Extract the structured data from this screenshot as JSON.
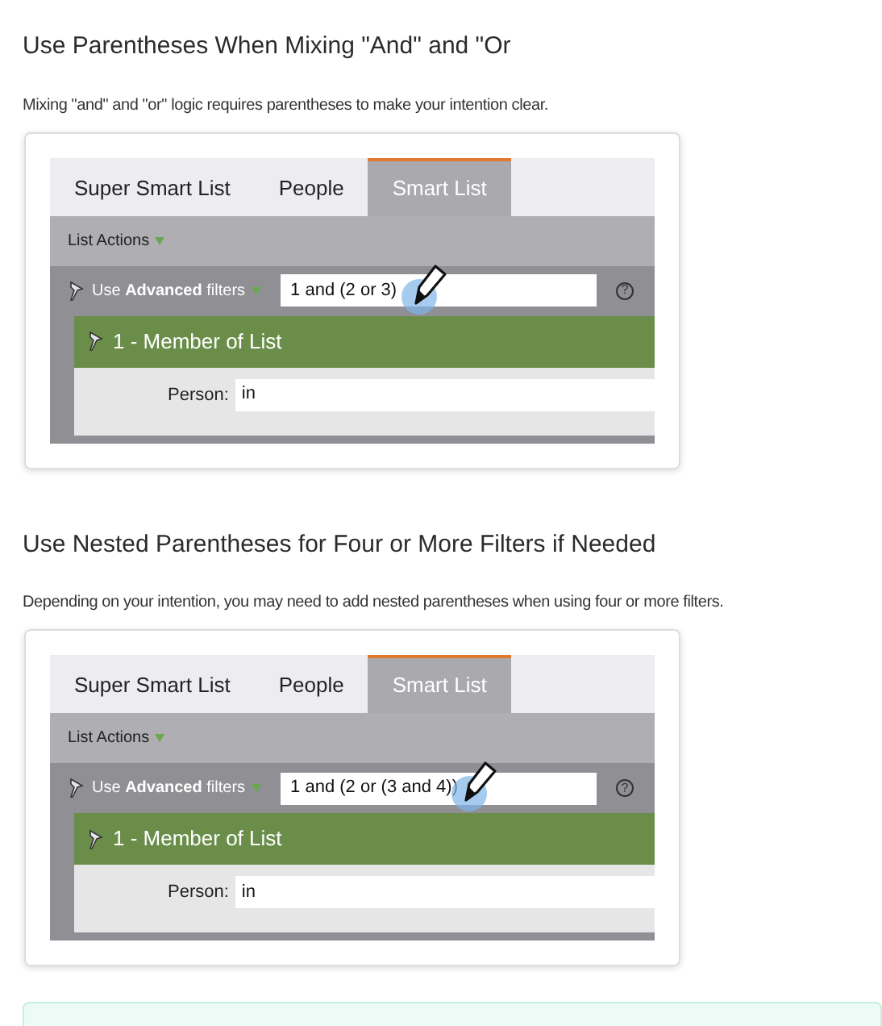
{
  "sections": [
    {
      "heading": "Use Parentheses When Mixing \"And\" and \"Or",
      "text": "Mixing \"and\" and \"or\" logic requires parentheses to make your intention clear.",
      "screenshot": {
        "tabs": [
          {
            "label": "Super Smart List",
            "selected": false
          },
          {
            "label": "People",
            "selected": false
          },
          {
            "label": "Smart List",
            "selected": true
          }
        ],
        "list_actions": "List Actions",
        "advanced_label": "Use **Advanced** filters",
        "filter_logic": "1 and (2 or 3)",
        "help": "?",
        "filter_title": "1 - Member of List",
        "field_label": "Person:",
        "field_value": "in"
      }
    },
    {
      "heading": "Use Nested Parentheses for Four or More Filters if Needed",
      "text": "Depending on your intention, you may need to add nested parentheses when using four or more filters.",
      "screenshot": {
        "tabs": [
          {
            "label": "Super Smart List",
            "selected": false
          },
          {
            "label": "People",
            "selected": false
          },
          {
            "label": "Smart List",
            "selected": true
          }
        ],
        "list_actions": "List Actions",
        "advanced_label": "Use **Advanced** filters",
        "filter_logic": "1 and (2 or (3 and 4))",
        "help": "?",
        "filter_title": "1 - Member of List",
        "field_label": "Person:",
        "field_value": "in"
      }
    }
  ]
}
